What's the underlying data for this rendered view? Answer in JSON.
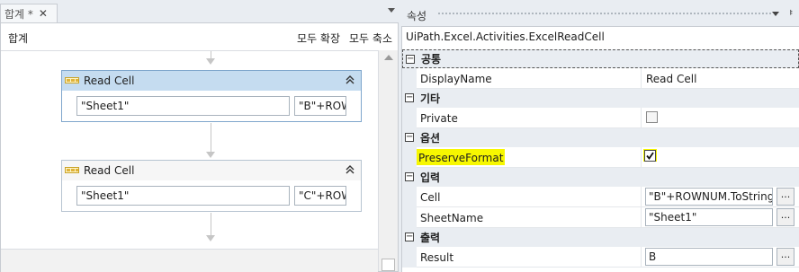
{
  "designer": {
    "tab_label": "합계 *",
    "tab_close": "✕",
    "title": "합계",
    "expand_all": "모두 확장",
    "collapse_all": "모두 축소",
    "activities": [
      {
        "title": "Read Cell",
        "sheet": "\"Sheet1\"",
        "cell": "\"B\"+ROW"
      },
      {
        "title": "Read Cell",
        "sheet": "\"Sheet1\"",
        "cell": "\"C\"+ROW"
      }
    ]
  },
  "properties": {
    "title": "속성",
    "pin": "ᅣ",
    "class_name": "UiPath.Excel.Activities.ExcelReadCell",
    "categories": {
      "common": "공통",
      "misc": "기타",
      "options": "옵션",
      "input": "입력",
      "output": "출력"
    },
    "rows": {
      "display_name": {
        "name": "DisplayName",
        "value": "Read Cell"
      },
      "private": {
        "name": "Private",
        "checked": false
      },
      "preserve_format": {
        "name": "PreserveFormat",
        "checked": true
      },
      "cell": {
        "name": "Cell",
        "value": "\"B\"+ROWNUM.ToString"
      },
      "sheet_name": {
        "name": "SheetName",
        "value": "\"Sheet1\""
      },
      "result": {
        "name": "Result",
        "value": "B"
      }
    },
    "ellipsis": "...",
    "highlight_color": "#f7f700"
  }
}
